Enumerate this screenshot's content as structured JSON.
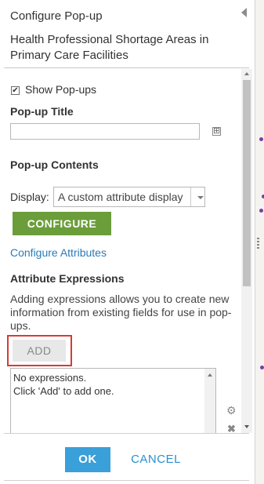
{
  "header": {
    "title": "Configure Pop-up",
    "layer_name": "Health Professional Shortage Areas in Primary Care Facilities"
  },
  "show_popups": {
    "label": "Show Pop-ups",
    "checked": true,
    "check_glyph": "✔"
  },
  "popup_title": {
    "heading": "Pop-up Title",
    "value": "",
    "add_field_icon": "⊞"
  },
  "popup_contents": {
    "heading": "Pop-up Contents",
    "display_label": "Display:",
    "display_value": "A custom attribute display",
    "configure_button": "CONFIGURE",
    "configure_attributes_link": "Configure Attributes"
  },
  "attribute_expressions": {
    "heading": "Attribute Expressions",
    "description": "Adding expressions allows you to create new information from existing fields for use in pop-ups.",
    "add_button": "ADD",
    "list_text_line1": "No expressions.",
    "list_text_line2": "Click 'Add' to add one.",
    "gear_icon": "⚙",
    "remove_icon": "✖"
  },
  "footer": {
    "ok_label": "OK",
    "cancel_label": "CANCEL"
  },
  "colors": {
    "configure_green": "#6b9e3a",
    "ok_blue": "#3aa0d9",
    "link_blue": "#2b7ab5",
    "highlight_red": "#d83a36"
  }
}
